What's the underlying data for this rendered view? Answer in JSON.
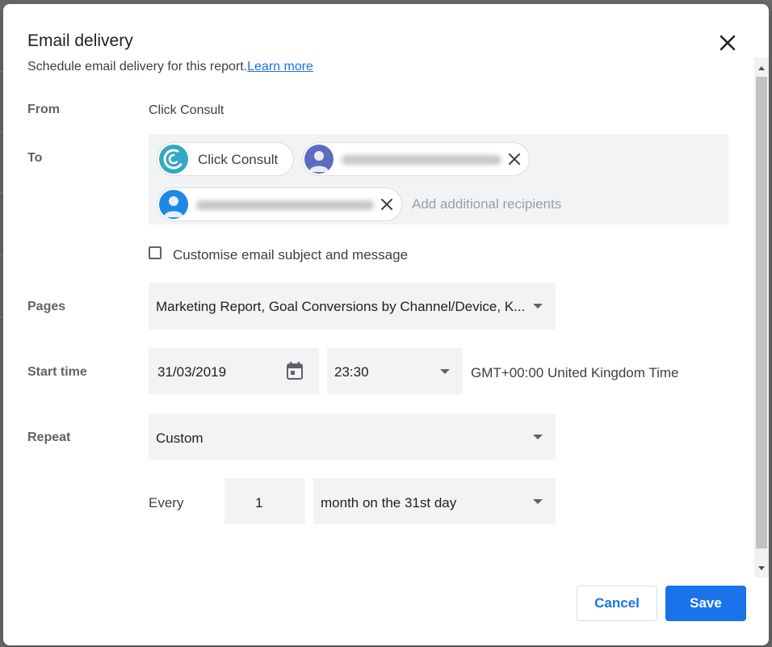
{
  "dialog": {
    "title": "Email delivery",
    "subtitle": "Schedule email delivery for this report.",
    "learn_more": "Learn more"
  },
  "from": {
    "label": "From",
    "value": "Click Consult"
  },
  "to": {
    "label": "To",
    "recipients": [
      {
        "name": "Click Consult"
      }
    ],
    "add_placeholder": "Add additional recipients"
  },
  "customise": {
    "label": "Customise email subject and message",
    "checked": false
  },
  "pages": {
    "label": "Pages",
    "value": "Marketing Report, Goal Conversions by Channel/Device, K..."
  },
  "start_time": {
    "label": "Start time",
    "date": "31/03/2019",
    "time": "23:30",
    "timezone": "GMT+00:00 United Kingdom Time"
  },
  "repeat": {
    "label": "Repeat",
    "value": "Custom",
    "every_label": "Every",
    "every_count": "1",
    "every_unit": "month on the 31st day"
  },
  "buttons": {
    "cancel": "Cancel",
    "save": "Save"
  },
  "colors": {
    "accent": "#1a73e8",
    "field_bg": "#f1f3f4",
    "label": "#5f6368",
    "click_consult_logo": "#35a8c4",
    "avatar_purple": "#5c6bc0",
    "avatar_blue": "#1e88e5"
  },
  "icons": [
    "close-icon",
    "click-consult-logo-icon",
    "person-avatar-icon",
    "remove-chip-icon",
    "calendar-icon",
    "dropdown-arrow-icon"
  ]
}
